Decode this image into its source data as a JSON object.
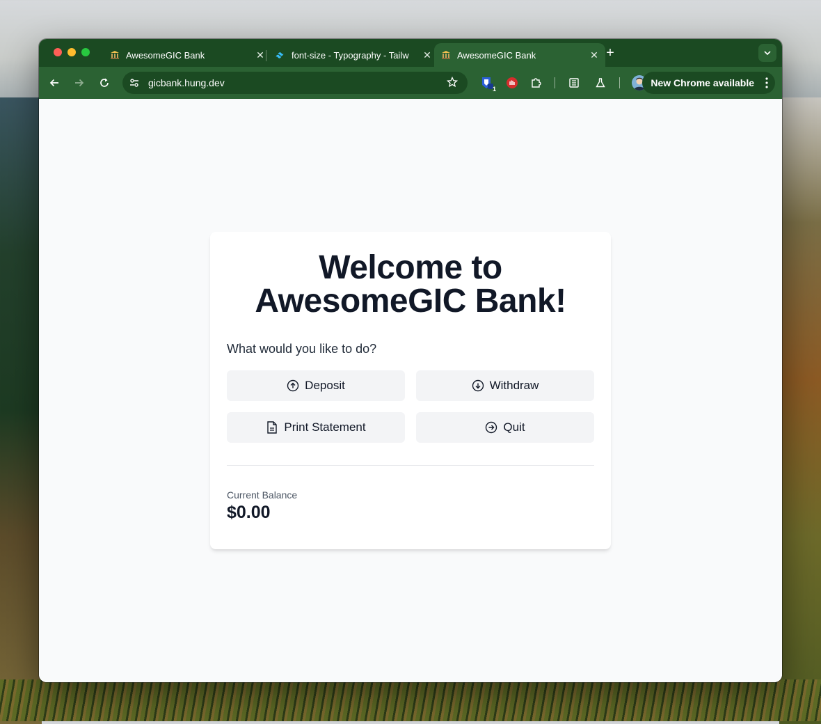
{
  "browser": {
    "tabs": [
      {
        "title": "AwesomeGIC Bank",
        "active": false,
        "favicon": "bank-icon"
      },
      {
        "title": "font-size - Typography - Tailw",
        "active": false,
        "favicon": "tailwind-icon"
      },
      {
        "title": "AwesomeGIC Bank",
        "active": true,
        "favicon": "bank-icon"
      }
    ],
    "url": "gicbank.hung.dev",
    "update_label": "New Chrome available",
    "extension_badge": "1",
    "theme_color": "#2b6233"
  },
  "page": {
    "headline_line1": "Welcome to",
    "headline_line2": "AwesomeGIC Bank!",
    "prompt": "What would you like to do?",
    "actions": [
      {
        "label": "Deposit",
        "icon": "arrow-up-circle-icon"
      },
      {
        "label": "Withdraw",
        "icon": "arrow-down-circle-icon"
      },
      {
        "label": "Print Statement",
        "icon": "document-icon"
      },
      {
        "label": "Quit",
        "icon": "arrow-right-circle-icon"
      }
    ],
    "balance_label": "Current Balance",
    "balance_value": "$0.00"
  }
}
